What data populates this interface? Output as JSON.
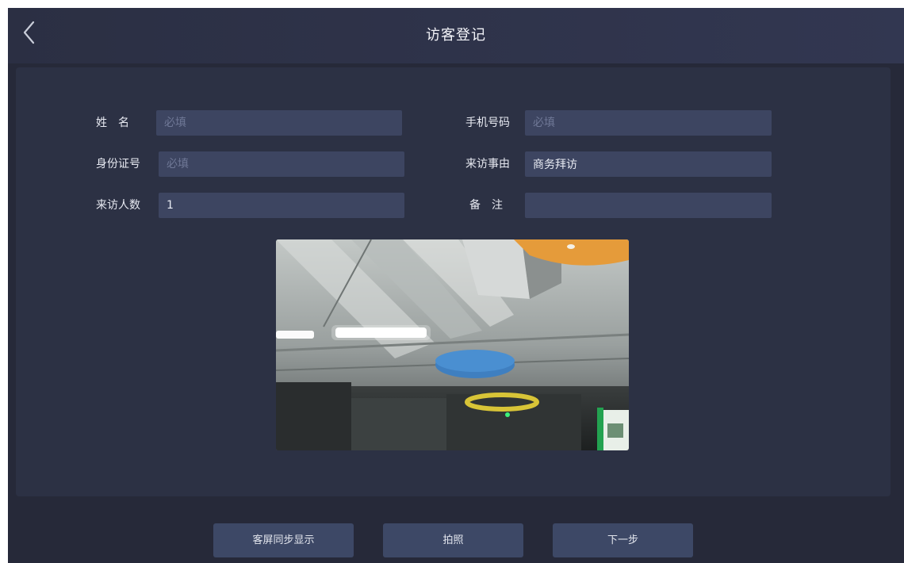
{
  "header": {
    "title": "访客登记",
    "back_icon": "chevron-left-icon"
  },
  "form": {
    "name": {
      "label": "姓　名",
      "placeholder": "必填",
      "value": ""
    },
    "phone": {
      "label": "手机号码",
      "placeholder": "必填",
      "value": ""
    },
    "id_number": {
      "label": "身份证号",
      "placeholder": "必填",
      "value": ""
    },
    "visit_reason": {
      "label": "来访事由",
      "placeholder": "",
      "value": "商务拜访"
    },
    "visitor_count": {
      "label": "来访人数",
      "placeholder": "",
      "value": "1"
    },
    "remark": {
      "label": "备　注",
      "placeholder": "",
      "value": ""
    }
  },
  "buttons": {
    "sync_display": "客屏同步显示",
    "take_photo": "拍照",
    "next_step": "下一步"
  },
  "colors": {
    "background": "#262939",
    "panel": "#2c3144",
    "input": "#3d4561",
    "button": "#3d4866"
  }
}
